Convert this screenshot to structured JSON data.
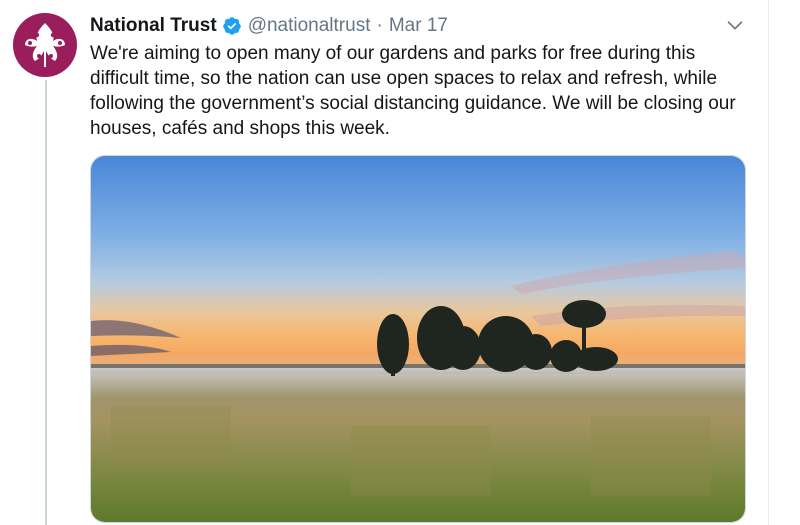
{
  "tweet": {
    "author_name": "National Trust",
    "author_handle": "@nationaltrust",
    "separator": "·",
    "date": "Mar 17",
    "text": "We're aiming to open many of our gardens and parks for free during this difficult time, so the nation can use open spaces to relax and refresh, while following the government’s social distancing guidance. We will be closing our houses, cafés and shops this week.",
    "verified": true
  },
  "icons": {
    "avatar": "oak-leaf-logo",
    "verified": "verified-badge-icon",
    "menu": "chevron-down-icon"
  },
  "colors": {
    "avatar_bg": "#9b1e5c",
    "verified": "#1da1f2",
    "secondary_text": "#657786",
    "primary_text": "#14171a"
  }
}
